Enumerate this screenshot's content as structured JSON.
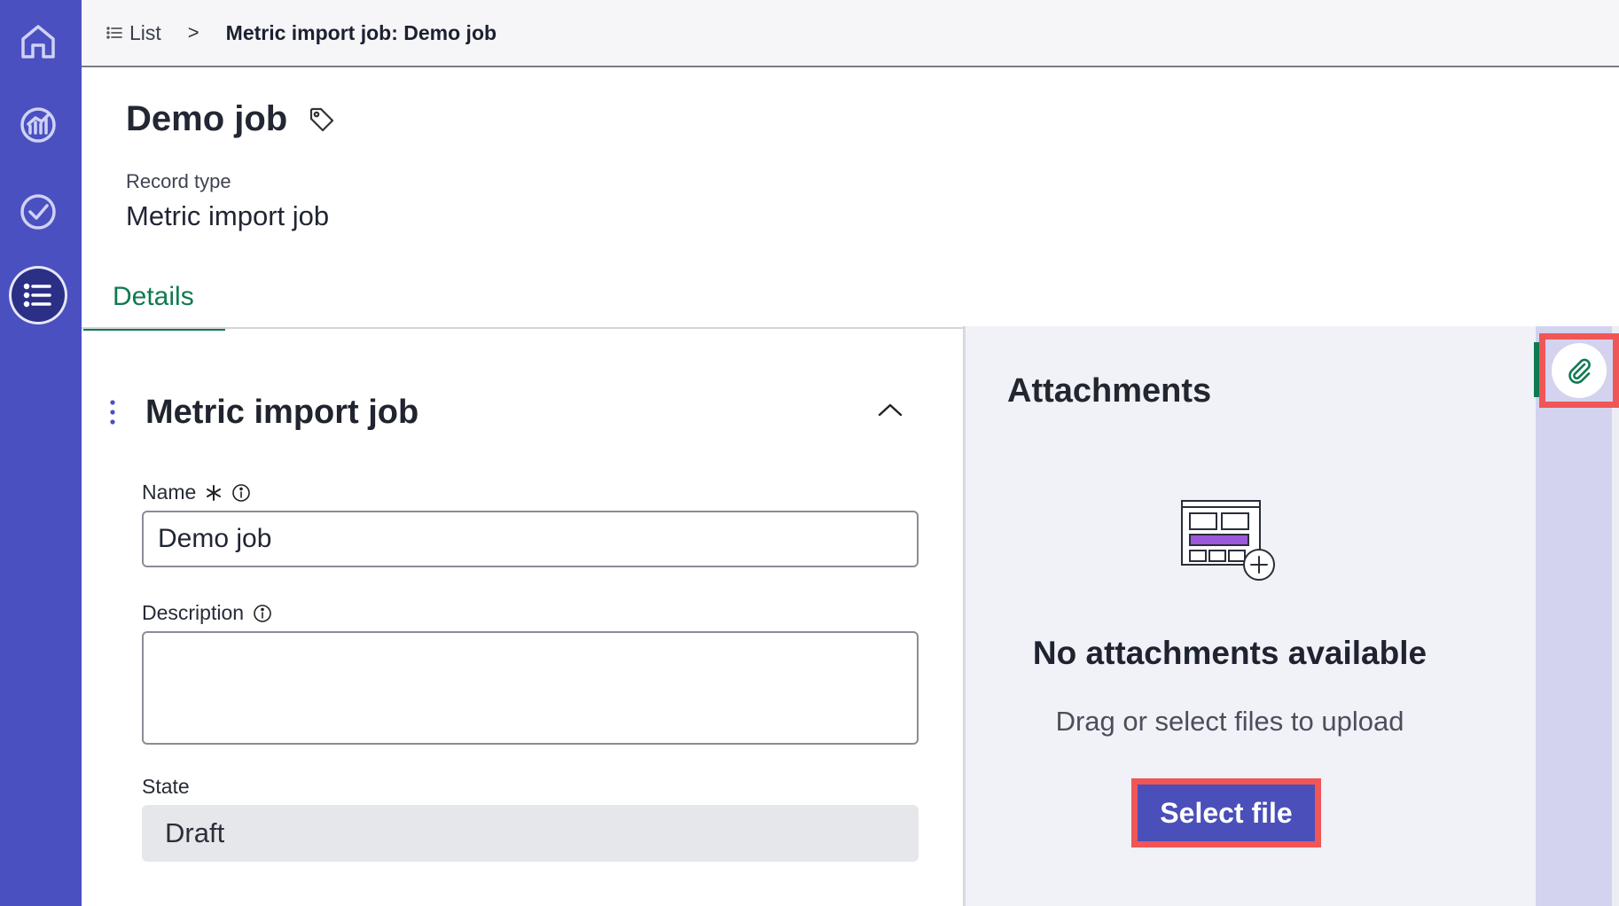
{
  "breadcrumb": {
    "list_label": "List",
    "separator": ">",
    "current": "Metric import job: Demo job"
  },
  "header": {
    "title": "Demo job",
    "record_type_label": "Record type",
    "record_type_value": "Metric import job"
  },
  "tabs": [
    {
      "label": "Details",
      "active": true
    }
  ],
  "form": {
    "section_title": "Metric import job",
    "name_label": "Name",
    "name_value": "Demo job",
    "description_label": "Description",
    "description_value": "",
    "state_label": "State",
    "state_value": "Draft"
  },
  "attachments": {
    "title": "Attachments",
    "empty_title": "No attachments available",
    "empty_subtitle": "Drag or select files to upload",
    "select_file_label": "Select file"
  },
  "icons": {
    "rail": [
      "home-icon",
      "analytics-icon",
      "check-circle-icon",
      "list-icon"
    ],
    "tag": "tag-icon",
    "paperclip": "paperclip-icon"
  },
  "colors": {
    "rail": "#4a50c0",
    "accent_green": "#0f7a4f",
    "primary_button": "#4a4fb9",
    "highlight": "#f05656"
  }
}
